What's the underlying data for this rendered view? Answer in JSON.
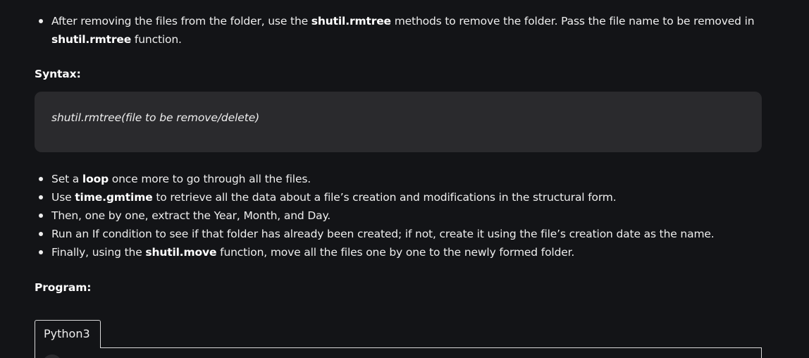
{
  "list_top": [
    {
      "parts": [
        {
          "t": "After removing the files from the folder, use the ",
          "b": false
        },
        {
          "t": "shutil.rmtree",
          "b": true
        },
        {
          "t": " methods to remove the folder. Pass the file name to be removed in ",
          "b": false
        },
        {
          "t": "shutil.rmtree",
          "b": true
        },
        {
          "t": " function.",
          "b": false
        }
      ]
    }
  ],
  "syntax_heading": "Syntax:",
  "syntax_code": "shutil.rmtree(file to be remove/delete)",
  "list_mid": [
    {
      "parts": [
        {
          "t": "Set a ",
          "b": false
        },
        {
          "t": "loop",
          "b": true
        },
        {
          "t": " once more to go through all the files.",
          "b": false
        }
      ]
    },
    {
      "parts": [
        {
          "t": "Use ",
          "b": false
        },
        {
          "t": "time.gmtime",
          "b": true
        },
        {
          "t": " to retrieve all the data about a file’s creation and modifications in the structural form.",
          "b": false
        }
      ]
    },
    {
      "parts": [
        {
          "t": "Then, one by one, extract the Year, Month, and Day.",
          "b": false
        }
      ]
    },
    {
      "parts": [
        {
          "t": "Run an If condition to see if that folder has already been created; if not, create it using the file’s creation date as the name.",
          "b": false
        }
      ]
    },
    {
      "parts": [
        {
          "t": "Finally, using the ",
          "b": false
        },
        {
          "t": "shutil.move",
          "b": true
        },
        {
          "t": " function, move all the files one by one to the newly formed folder.",
          "b": false
        }
      ]
    }
  ],
  "program_heading": "Program:",
  "tabs": [
    {
      "label": "Python3"
    }
  ]
}
